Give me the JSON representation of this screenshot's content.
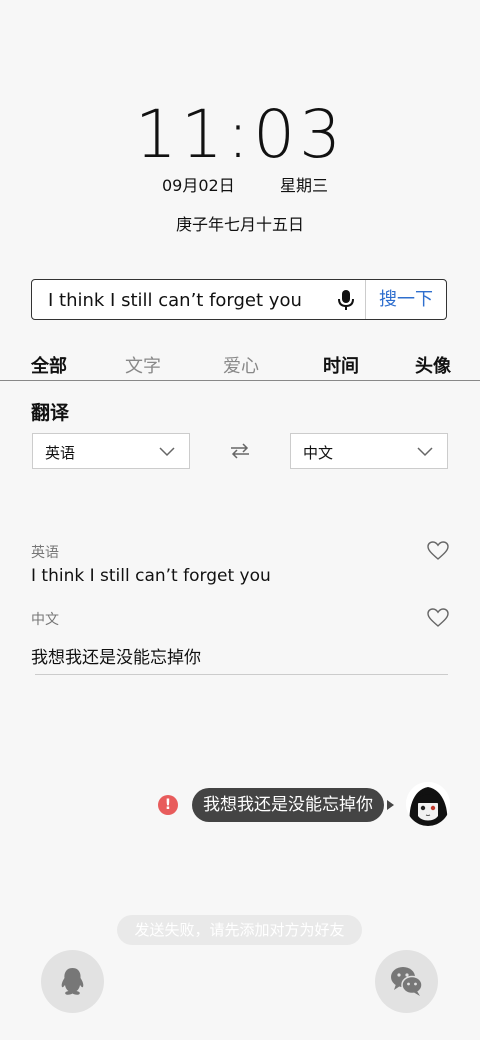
{
  "clock": {
    "time": "11:03",
    "date": "09月02日",
    "weekday": "星期三",
    "lunar": "庚子年七月十五日"
  },
  "search": {
    "value": "I think I still can’t forget you",
    "button": "搜一下"
  },
  "tabs": [
    {
      "label": "全部",
      "weight": "bold"
    },
    {
      "label": "文字",
      "weight": "light"
    },
    {
      "label": "爱心",
      "weight": "light"
    },
    {
      "label": "时间",
      "weight": "bold"
    },
    {
      "label": "头像",
      "weight": "bold"
    }
  ],
  "translate": {
    "title": "翻译",
    "source_lang": "英语",
    "target_lang": "中文",
    "source_label": "英语",
    "source_text": "I think I still can’t forget you",
    "target_label": "中文",
    "target_text": "我想我还是没能忘掉你"
  },
  "chat": {
    "message": "我想我还是没能忘掉你",
    "error_icon": "!"
  },
  "toast": "发送失败，请先添加对方为好友",
  "colors": {
    "accent": "#2f6fce",
    "error": "#e85c5c",
    "bubble": "#444444"
  },
  "icons": [
    "microphone-icon",
    "chevron-down-icon",
    "swap-icon",
    "heart-icon",
    "qq-penguin-icon",
    "wechat-icon"
  ]
}
